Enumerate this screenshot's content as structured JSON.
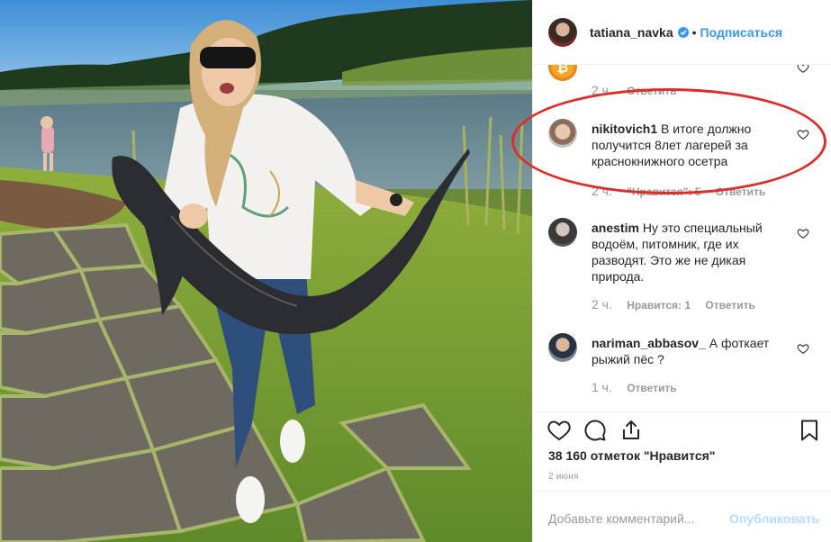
{
  "header": {
    "username": "tatiana_navka",
    "separator": "•",
    "follow_label": "Подписаться"
  },
  "comments": [
    {
      "author": "",
      "text": "",
      "time": "2 ч.",
      "likes": "",
      "reply": "Ответить"
    },
    {
      "author": "nikitovich1",
      "text": "В итоге должно получится 8лет лагерей за краснокнижного осетра",
      "time": "2 ч.",
      "likes": "\"Нравится\": 5",
      "reply": "Ответить"
    },
    {
      "author": "anestim",
      "text": "Ну это специальный водоём, питомник, где их разводят. Это же не дикая природа.",
      "time": "2 ч.",
      "likes": "Нравится: 1",
      "reply": "Ответить"
    },
    {
      "author": "nariman_abbasov_",
      "text": "А фоткает рыжий пёс ?",
      "time": "1 ч.",
      "likes": "",
      "reply": "Ответить"
    }
  ],
  "post": {
    "likes_count": "38 160 отметок \"Нравится\"",
    "date": "2 июня"
  },
  "add_comment": {
    "placeholder": "Добавьте комментарий...",
    "publish_label": "Опубликовать"
  },
  "icons": {
    "verified": "verified-badge-icon",
    "like": "heart-icon",
    "comment": "comment-bubble-icon",
    "share": "share-icon",
    "save": "bookmark-icon"
  },
  "colors": {
    "link_blue": "#3897f0",
    "publish_disabled": "#b2dffc",
    "annotation_red": "#d9302a",
    "muted_text": "#999999"
  }
}
